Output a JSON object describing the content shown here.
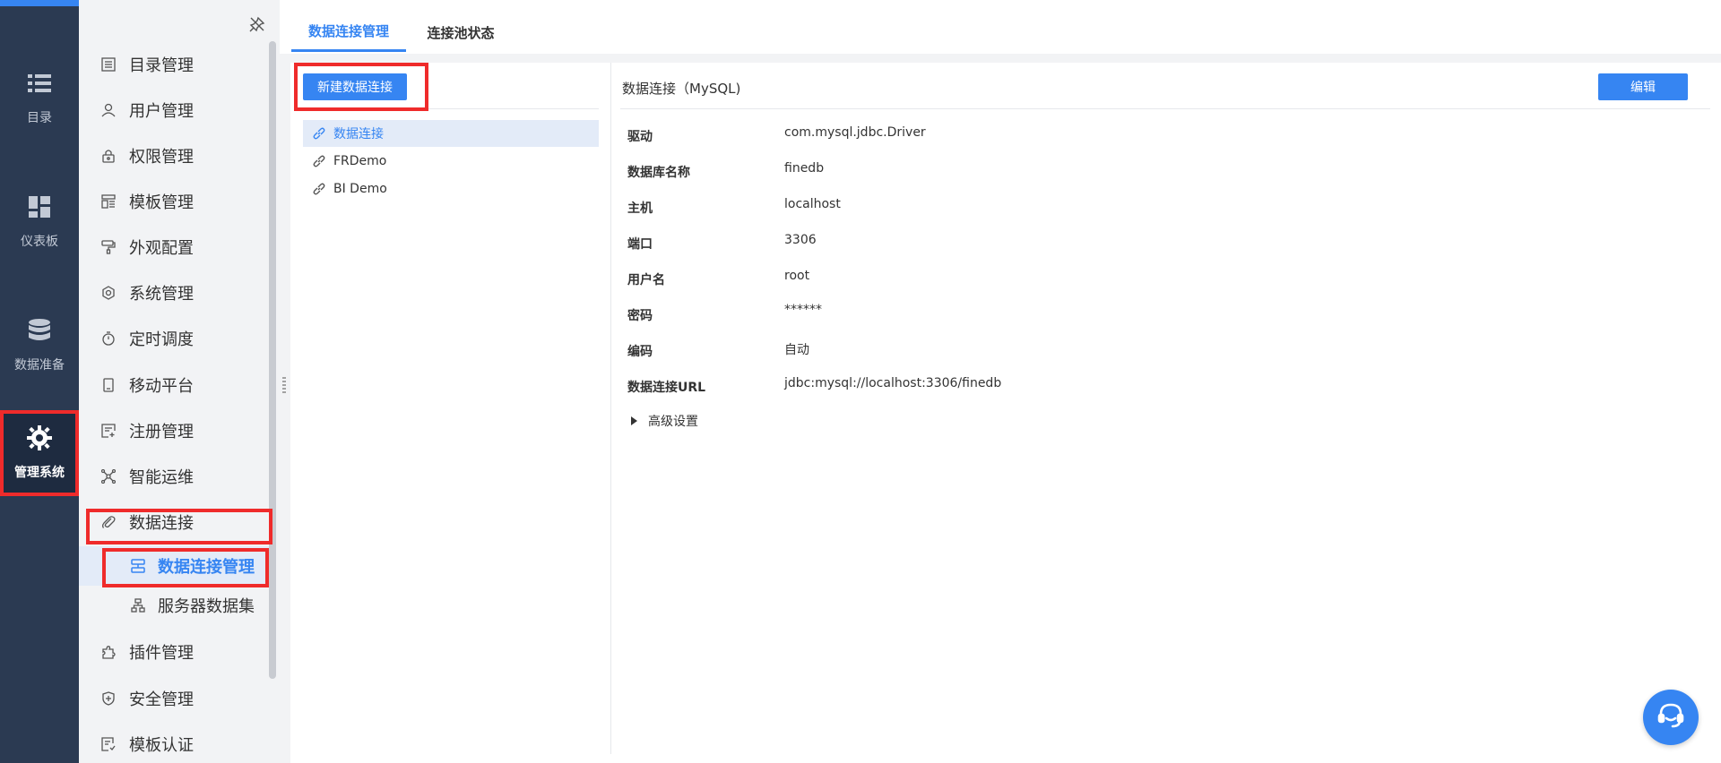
{
  "rail": {
    "items": [
      {
        "label": "目录",
        "icon": "list-icon"
      },
      {
        "label": "仪表板",
        "icon": "dashboard-icon"
      },
      {
        "label": "数据准备",
        "icon": "database-icon"
      },
      {
        "label": "管理系统",
        "icon": "gear-icon"
      }
    ]
  },
  "menu": {
    "items": [
      {
        "label": "目录管理",
        "icon": "directory-icon"
      },
      {
        "label": "用户管理",
        "icon": "user-icon"
      },
      {
        "label": "权限管理",
        "icon": "lock-icon"
      },
      {
        "label": "模板管理",
        "icon": "template-icon"
      },
      {
        "label": "外观配置",
        "icon": "paint-roller-icon"
      },
      {
        "label": "系统管理",
        "icon": "settings-icon"
      },
      {
        "label": "定时调度",
        "icon": "timer-icon"
      },
      {
        "label": "移动平台",
        "icon": "mobile-icon"
      },
      {
        "label": "注册管理",
        "icon": "register-icon"
      },
      {
        "label": "智能运维",
        "icon": "network-icon"
      },
      {
        "label": "数据连接",
        "icon": "paperclip-icon"
      },
      {
        "label": "插件管理",
        "icon": "plugin-icon"
      },
      {
        "label": "安全管理",
        "icon": "shield-icon"
      },
      {
        "label": "模板认证",
        "icon": "certificate-icon"
      }
    ],
    "sub_items": [
      {
        "label": "数据连接管理",
        "icon": "connection-manage-icon"
      },
      {
        "label": "服务器数据集",
        "icon": "dataset-icon"
      }
    ]
  },
  "tabs": [
    {
      "label": "数据连接管理"
    },
    {
      "label": "连接池状态"
    }
  ],
  "left_panel": {
    "new_button": "新建数据连接",
    "connections": [
      "数据连接",
      "FRDemo",
      "BI Demo"
    ]
  },
  "detail": {
    "title": "数据连接（MySQL)",
    "edit_button": "编辑",
    "fields": [
      {
        "label": "驱动",
        "value": "com.mysql.jdbc.Driver"
      },
      {
        "label": "数据库名称",
        "value": "finedb"
      },
      {
        "label": "主机",
        "value": "localhost"
      },
      {
        "label": "端口",
        "value": "3306"
      },
      {
        "label": "用户名",
        "value": "root"
      },
      {
        "label": "密码",
        "value": "******"
      },
      {
        "label": "编码",
        "value": "自动"
      },
      {
        "label": "数据连接URL",
        "value": "jdbc:mysql://localhost:3306/finedb"
      }
    ],
    "advanced": "高级设置"
  },
  "colors": {
    "accent": "#3685f2",
    "rail": "#2b3a52",
    "highlight": "#ef2b2b"
  }
}
